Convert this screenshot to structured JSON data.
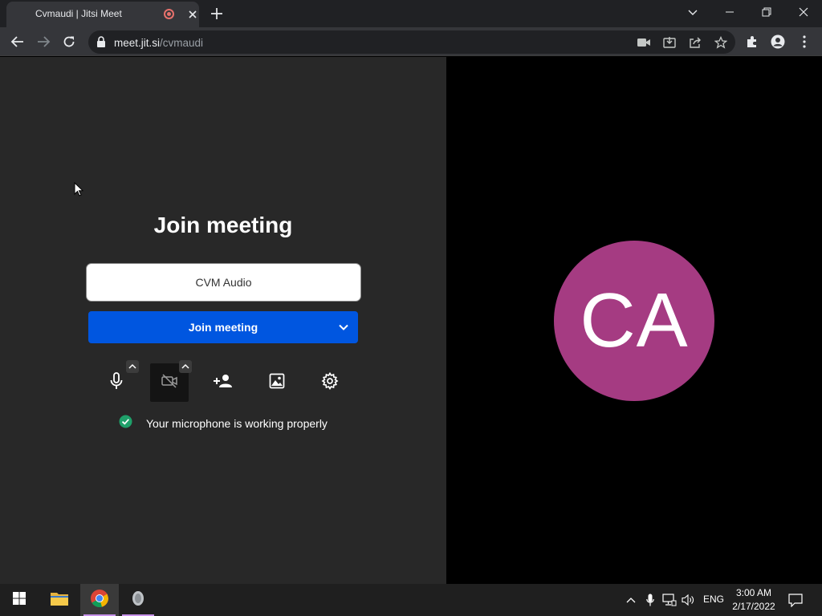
{
  "browser": {
    "tab_title": "Cvmaudi | Jitsi Meet",
    "url_domain": "meet.jit.si",
    "url_path": "/cvmaudi"
  },
  "page": {
    "title": "Join meeting",
    "name_value": "CVM Audio",
    "join_button_label": "Join meeting",
    "status_text": "Your microphone is working properly",
    "avatar_initials": "CA",
    "avatar_color": "#a53b82",
    "join_button_color": "#0056e0"
  },
  "taskbar": {
    "language": "ENG",
    "time": "3:00 AM",
    "date": "2/17/2022"
  }
}
